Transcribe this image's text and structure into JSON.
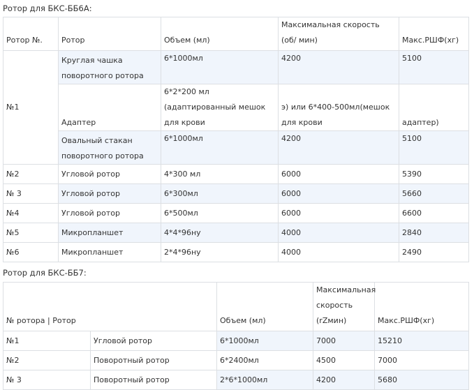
{
  "section1": {
    "caption": "Ротор для БКС-ББ6А:",
    "headers": [
      "Ротор №.",
      "Ротор",
      "Объем (мл)",
      "Максимальная скорость (об/ мин)",
      "Макс.РШФ(хг)"
    ],
    "group_label": "№1",
    "rows": [
      {
        "rotor": "Круглая чашка поворотного ротора",
        "volume": "6*1000мл",
        "speed": "4200",
        "rcf": "5100"
      },
      {
        "rotor": "Адаптер",
        "volume": "6*2*200 мл (адаптированный мешок для крови",
        "speed": "э) или 6*400-500мл(мешок для крови",
        "rcf": "адаптер)"
      },
      {
        "rotor": "Овальный стакан поворотного ротора",
        "volume": "6*1000мл",
        "speed": "4200",
        "rcf": "5100"
      },
      {
        "num": "№2",
        "rotor": "Угловой ротор",
        "volume": "4*300 мл",
        "speed": "6000",
        "rcf": "5390"
      },
      {
        "num": "№ 3",
        "rotor": "Угловой ротор",
        "volume": "6*300мл",
        "speed": "6000",
        "rcf": "5660"
      },
      {
        "num": "№4",
        "rotor": "Угловой ротор",
        "volume": "6*500мл",
        "speed": "6000",
        "rcf": "6600"
      },
      {
        "num": "№5",
        "rotor": "Микропланшет",
        "volume": "4*4*96ну",
        "speed": "4000",
        "rcf": "2840"
      },
      {
        "num": "№6",
        "rotor": "Микропланшет",
        "volume": "2*4*96ну",
        "speed": "4000",
        "rcf": "2490"
      }
    ]
  },
  "section2": {
    "caption": "Ротор для БКС-ББ7:",
    "headers": [
      "№ ротора | Ротор",
      "Объем (мл)",
      "Максимальная скорость (rZмин)",
      "Макс.РШФ(хг)"
    ],
    "rows": [
      {
        "num": "№1",
        "rotor": "Угловой ротор",
        "volume": "6*1000мл",
        "speed": "7000",
        "rcf": "15210"
      },
      {
        "num": "№2",
        "rotor": "Поворотный ротор",
        "volume": "6*2400мл",
        "speed": "4500",
        "rcf": "7000"
      },
      {
        "num": "№ 3",
        "rotor": "Поворотный ротор",
        "volume": "2*6*1000мл",
        "speed": "4200",
        "rcf": "5680"
      }
    ]
  }
}
